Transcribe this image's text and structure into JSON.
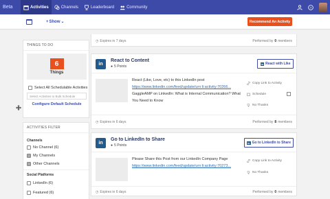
{
  "nav": {
    "brand": "Beta",
    "items": [
      {
        "label": "Activities",
        "icon": "calendar-icon"
      },
      {
        "label": "Channels",
        "icon": "chat-icon"
      },
      {
        "label": "Leaderboard",
        "icon": "trophy-icon"
      },
      {
        "label": "Community",
        "icon": "community-icon"
      }
    ],
    "right_icons": [
      "user-icon",
      "help-icon",
      "avatar"
    ]
  },
  "toolbar": {
    "show_label": "Show",
    "recommend_label": "Recommend An Activity"
  },
  "todo": {
    "header": "THINGS TO DO",
    "count": "6",
    "count_label": "Things",
    "select_all_label": "Select All Schedulable Activities",
    "bulk_placeholder": "Select Activities to Bulk Schedule",
    "config_link": "Configure Default Schedule"
  },
  "filter": {
    "header": "ACTIVITIES FILTER",
    "channels_title": "Channels",
    "channels": [
      {
        "label": "No Channel (6)",
        "checked": false
      },
      {
        "label": "My Channels",
        "checked": true
      },
      {
        "label": "Other Channels",
        "checked": true
      }
    ],
    "platforms_title": "Social Platforms",
    "platforms": [
      {
        "label": "LinkedIn (6)",
        "checked": false
      },
      {
        "label": "Featured (6)",
        "checked": false
      }
    ]
  },
  "top_partial": {
    "expires": "Expires in 7 days",
    "performed_prefix": "Performed by",
    "performed_count": "0",
    "performed_suffix": "members"
  },
  "activities": [
    {
      "title": "React to Content",
      "points": "5 Points",
      "button": "React with Like",
      "text1": "React (Like, Love, etc) to this LinkedIn post",
      "link": "https://www.linkedin.com/feed/update/urn:li:activity:70266...",
      "text2": "GaggleAMP on LinkedIn: What is Internal Communication? What You Need to Know",
      "actions": [
        "Copy Link to Activity",
        "Schedule",
        "No Thanks"
      ],
      "expires": "Expires in 6 days",
      "performed_prefix": "Performed by",
      "performed_count": "8",
      "performed_suffix": "members"
    },
    {
      "title": "Go to LinkedIn to Share",
      "points": "5 Points",
      "button": "Go to LinkedIn to Share",
      "text1": "Please Share this Post from our LinkedIn Company Page",
      "link": "https://www.linkedin.com/feed/update/urn:li:activity:70273...",
      "actions": [
        "Copy Link to Activity",
        "No Thanks"
      ],
      "expires": "Expires in 6 days",
      "performed_prefix": "Performed by",
      "performed_count": "0",
      "performed_suffix": "members"
    }
  ],
  "colors": {
    "nav_bg": "#3d4aa8",
    "accent_orange": "#e8501e",
    "linkedin_blue": "#225a8c",
    "link_blue": "#2a6bb3"
  }
}
